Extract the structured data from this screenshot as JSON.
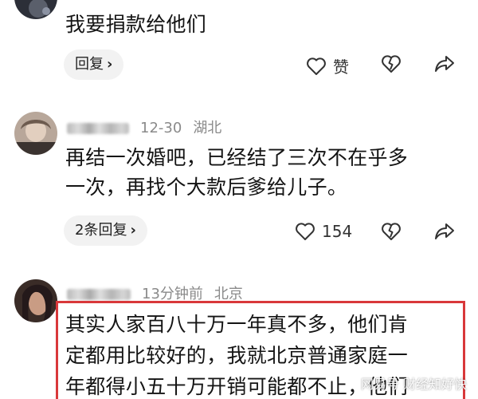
{
  "comments": [
    {
      "text": "我要捐款给他们",
      "reply_label": "回复",
      "like_label": "赞"
    },
    {
      "date": "12-30",
      "location": "湖北",
      "text_line1": "再结一次婚吧，已经结了三次不在乎多",
      "text_line2": "一次，再找个大款后爹给儿子。",
      "reply_label": "2条回复",
      "like_count": "154"
    },
    {
      "time": "13分钟前",
      "location": "北京",
      "text_line1": "其实人家百八十万一年真不多，他们肯",
      "text_line2": "定都用比较好的，我就北京普通家庭一",
      "text_line3": "年都得小五十万开销可能都不止，他们"
    }
  ],
  "watermark": "网易号 财经知好快",
  "colors": {
    "highlight_border": "#d9383a",
    "meta_text": "#8a8a8a",
    "reply_bg": "#f2f2f2"
  },
  "icons": [
    "heart-icon",
    "broken-heart-icon",
    "share-icon",
    "chevron-right-icon"
  ]
}
